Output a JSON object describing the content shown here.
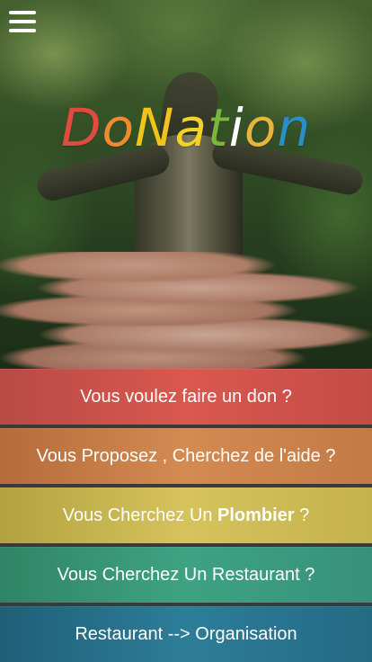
{
  "header": {
    "menu_icon": "hamburger-menu-icon"
  },
  "logo": {
    "letters": [
      {
        "char": "D",
        "color": "#e04b3f"
      },
      {
        "char": "o",
        "color": "#f08a2e"
      },
      {
        "char": "N",
        "color": "#f2c318"
      },
      {
        "char": "a",
        "color": "#f3d323"
      },
      {
        "char": "t",
        "color": "#79b73c"
      },
      {
        "char": "i",
        "color": "#ffffff"
      },
      {
        "char": "o",
        "color": "#e8b43a"
      },
      {
        "char": "n",
        "color": "#2a8fc9"
      }
    ]
  },
  "actions": {
    "don_label": "Vous voulez faire un don ?",
    "aide_label": "Vous Proposez , Cherchez de l'aide ?",
    "plombier_prefix": "Vous Cherchez Un ",
    "plombier_bold": "Plombier",
    "plombier_suffix": " ?",
    "restaurant_label": "Vous Cherchez Un Restaurant ?",
    "organisation_label": "Restaurant --> Organisation"
  },
  "colors": {
    "don": "#d9584f",
    "aide": "#d38b52",
    "plombier": "#d6c35c",
    "restaurant": "#3ea382",
    "organisation": "#2d7d99"
  }
}
